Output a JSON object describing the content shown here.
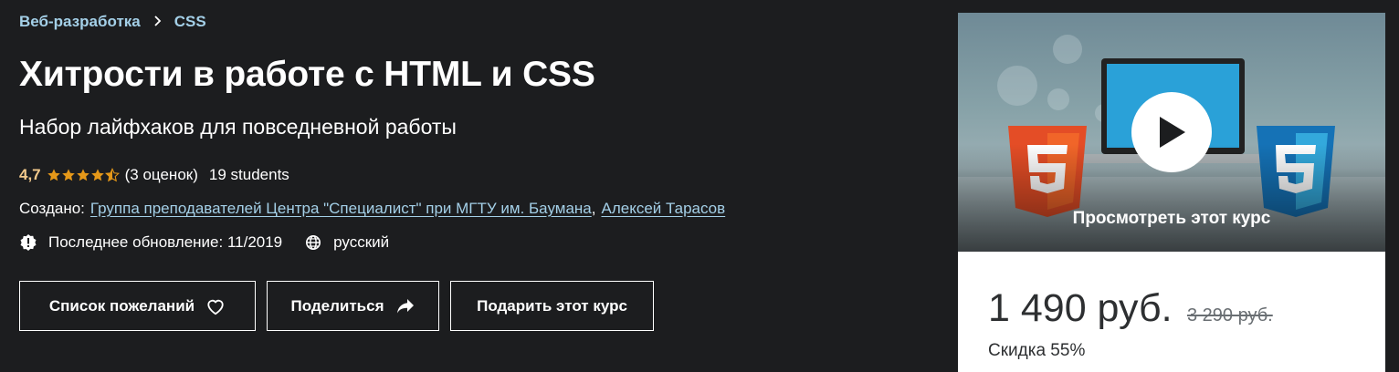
{
  "breadcrumb": {
    "items": [
      "Веб-разработка",
      "CSS"
    ],
    "separator": ">"
  },
  "course": {
    "title": "Хитрости в работе с HTML и CSS",
    "subtitle": "Набор лайфхаков для повседневной работы",
    "rating": "4,7",
    "rating_value": 4.7,
    "ratings_count": "(3 оценок)",
    "students": "19 students",
    "created_label": "Создано:",
    "authors": [
      "Группа преподавателей Центра \"Специалист\" при МГТУ им. Баумана",
      "Алексей Тарасов"
    ],
    "author_separator": ",",
    "last_updated": "Последнее обновление: 11/2019",
    "language": "русский"
  },
  "actions": {
    "wishlist_label": "Список пожеланий",
    "share_label": "Поделиться",
    "gift_label": "Подарить этот курс"
  },
  "preview": {
    "label": "Просмотреть этот курс"
  },
  "pricing": {
    "price": "1 490 руб.",
    "old_price": "3 290 руб.",
    "discount": "Скидка 55%"
  },
  "colors": {
    "background": "#1c1d1f",
    "link": "#a4d0e8",
    "rating": "#f3ca8c",
    "star": "#e59819"
  }
}
